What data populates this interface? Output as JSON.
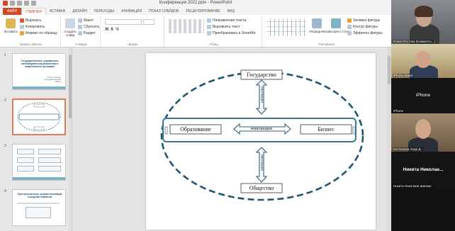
{
  "window": {
    "title": "Конференция 2022.pptx - PowerPoint"
  },
  "tabs": [
    {
      "label": "ФАЙЛ"
    },
    {
      "label": "ГЛАВНАЯ"
    },
    {
      "label": "ВСТАВКА"
    },
    {
      "label": "ДИЗАЙН"
    },
    {
      "label": "ПЕРЕХОДЫ"
    },
    {
      "label": "АНИМАЦИЯ"
    },
    {
      "label": "ПОКАЗ СЛАЙДОВ"
    },
    {
      "label": "РЕЦЕНЗИРОВАНИЕ"
    },
    {
      "label": "ВИД"
    }
  ],
  "ribbon": {
    "clipboard": {
      "paste": "Вставить",
      "cut": "Вырезать",
      "copy": "Копировать",
      "format": "Формат по образцу",
      "label": "Буфер обмена"
    },
    "slides": {
      "new": "Создать слайд",
      "layout": "Макет",
      "reset": "Сбросить",
      "section": "Раздел",
      "label": "Слайды"
    },
    "font": {
      "label": "Шрифт"
    },
    "paragraph": {
      "text_direction": "Направление текста",
      "align_text": "Выровнять текст",
      "smartart": "Преобразовать в SmartArt",
      "label": "Абзац"
    },
    "drawing": {
      "arrange": "Упорядочить",
      "quick_styles": "Экспресс-стили",
      "fill": "Заливка фигуры",
      "outline": "Контур фигуры",
      "effects": "Эффекты фигуры",
      "label": "Рисование"
    }
  },
  "thumbnails": [
    {
      "num": "1",
      "title": "Государственное управление инновационным развитием в современных условиях",
      "subtitle": "Отчет о научно-исследовательской работе"
    },
    {
      "num": "2"
    },
    {
      "num": "3"
    },
    {
      "num": "4",
      "title": "Пространственные условия инноваций и средства обработки"
    }
  ],
  "slide": {
    "top": "Государство",
    "left": "Образование",
    "center": "инновации",
    "right": "Бизнес",
    "bottom": "Общество",
    "v_top": "инновации",
    "v_bottom": "инновации"
  },
  "participants": [
    {
      "name": "Юлия Пестова (Клименто...)"
    },
    {
      "name": "iPhone Saveli"
    },
    {
      "name": "iPhone",
      "center": "iPhone"
    },
    {
      "name": "Костюкова Аида Д..."
    },
    {
      "name": "Никита Николаев Шапкин",
      "center": "Никита Николае..."
    }
  ]
}
